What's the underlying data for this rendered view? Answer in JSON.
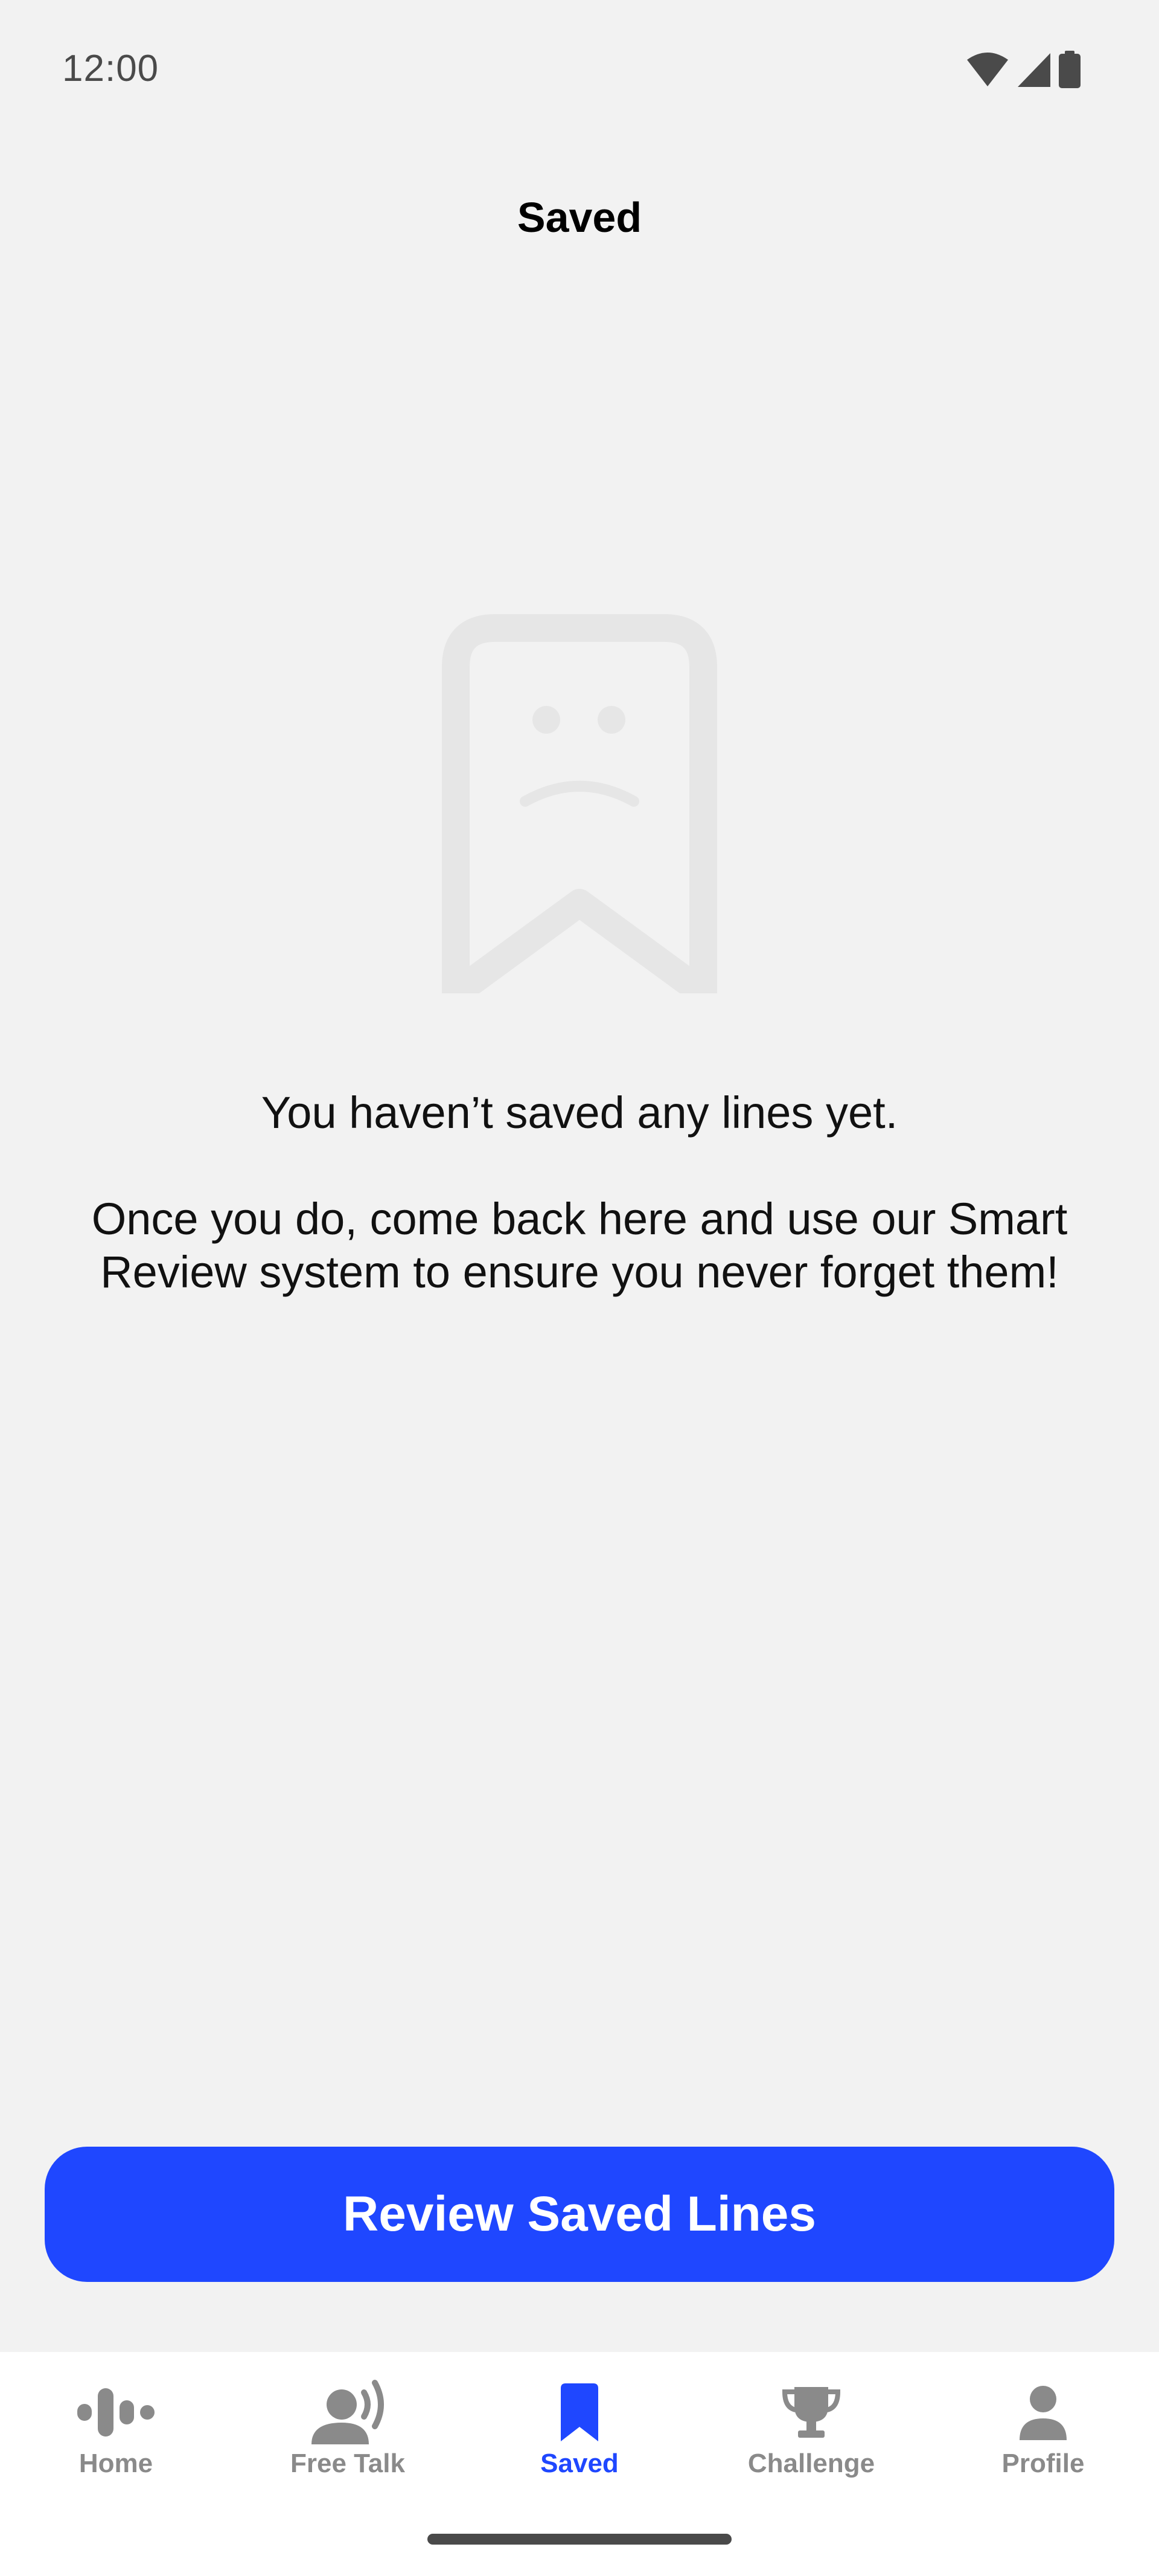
{
  "status_bar": {
    "time": "12:00",
    "icons": [
      "wifi-icon",
      "signal-icon",
      "battery-icon"
    ]
  },
  "header": {
    "title": "Saved"
  },
  "empty_state": {
    "illustration": "sad-bookmark-icon",
    "title": "You haven’t saved any lines yet.",
    "body": "Once you do, come back here and use our Smart Review system to ensure you never forget them!"
  },
  "cta": {
    "label": "Review Saved Lines"
  },
  "bottom_nav": {
    "items": [
      {
        "label": "Home",
        "icon": "waveform-icon",
        "active": false
      },
      {
        "label": "Free Talk",
        "icon": "speaking-person-icon",
        "active": false
      },
      {
        "label": "Saved",
        "icon": "bookmark-icon",
        "active": true
      },
      {
        "label": "Challenge",
        "icon": "trophy-icon",
        "active": false
      },
      {
        "label": "Profile",
        "icon": "person-icon",
        "active": false
      }
    ]
  },
  "colors": {
    "background": "#f2f2f2",
    "accent": "#1f47ff",
    "inactive": "#8a8a8a",
    "illustration": "#e6e6e6"
  }
}
